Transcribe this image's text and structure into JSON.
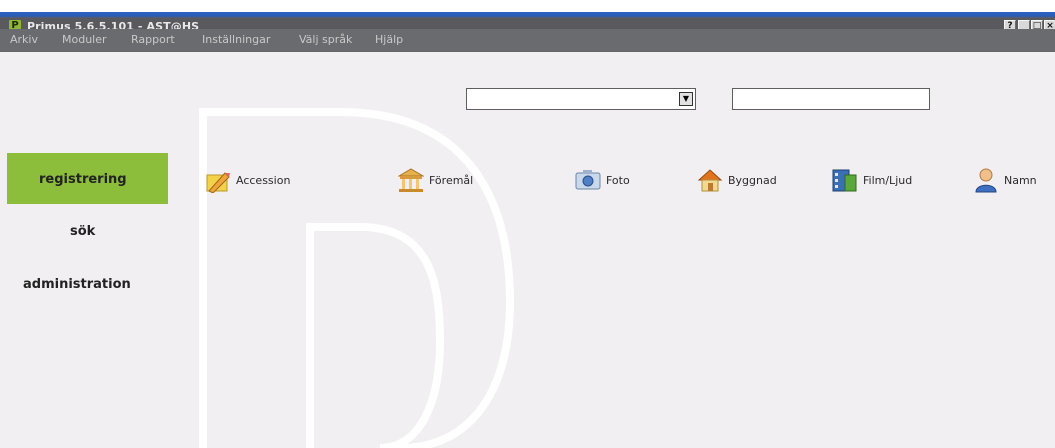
{
  "window": {
    "title": "Primus 5.6.5.101 - AST@HS",
    "logo_letter": "P",
    "controls": [
      "?",
      "_",
      "□",
      "×"
    ]
  },
  "menu": [
    "Arkiv",
    "Moduler",
    "Rapport",
    "Inställningar",
    "Välj språk",
    "Hjälp"
  ],
  "search": {
    "combo_value": "",
    "text_value": ""
  },
  "nav": {
    "items": [
      {
        "label": "registrering",
        "active": true
      },
      {
        "label": "sök",
        "active": false
      },
      {
        "label": "administration",
        "active": false
      }
    ]
  },
  "modules": [
    {
      "label": "Accession",
      "icon": "pencil-note-icon"
    },
    {
      "label": "Föremål",
      "icon": "museum-building-icon"
    },
    {
      "label": "Foto",
      "icon": "camera-icon"
    },
    {
      "label": "Byggnad",
      "icon": "house-icon"
    },
    {
      "label": "Film/Ljud",
      "icon": "film-sound-icon"
    },
    {
      "label": "Namn",
      "icon": "person-icon"
    }
  ],
  "colors": {
    "accent": "#8cbd3b",
    "titlebar": "#59595e",
    "background": "#f1eff1"
  }
}
